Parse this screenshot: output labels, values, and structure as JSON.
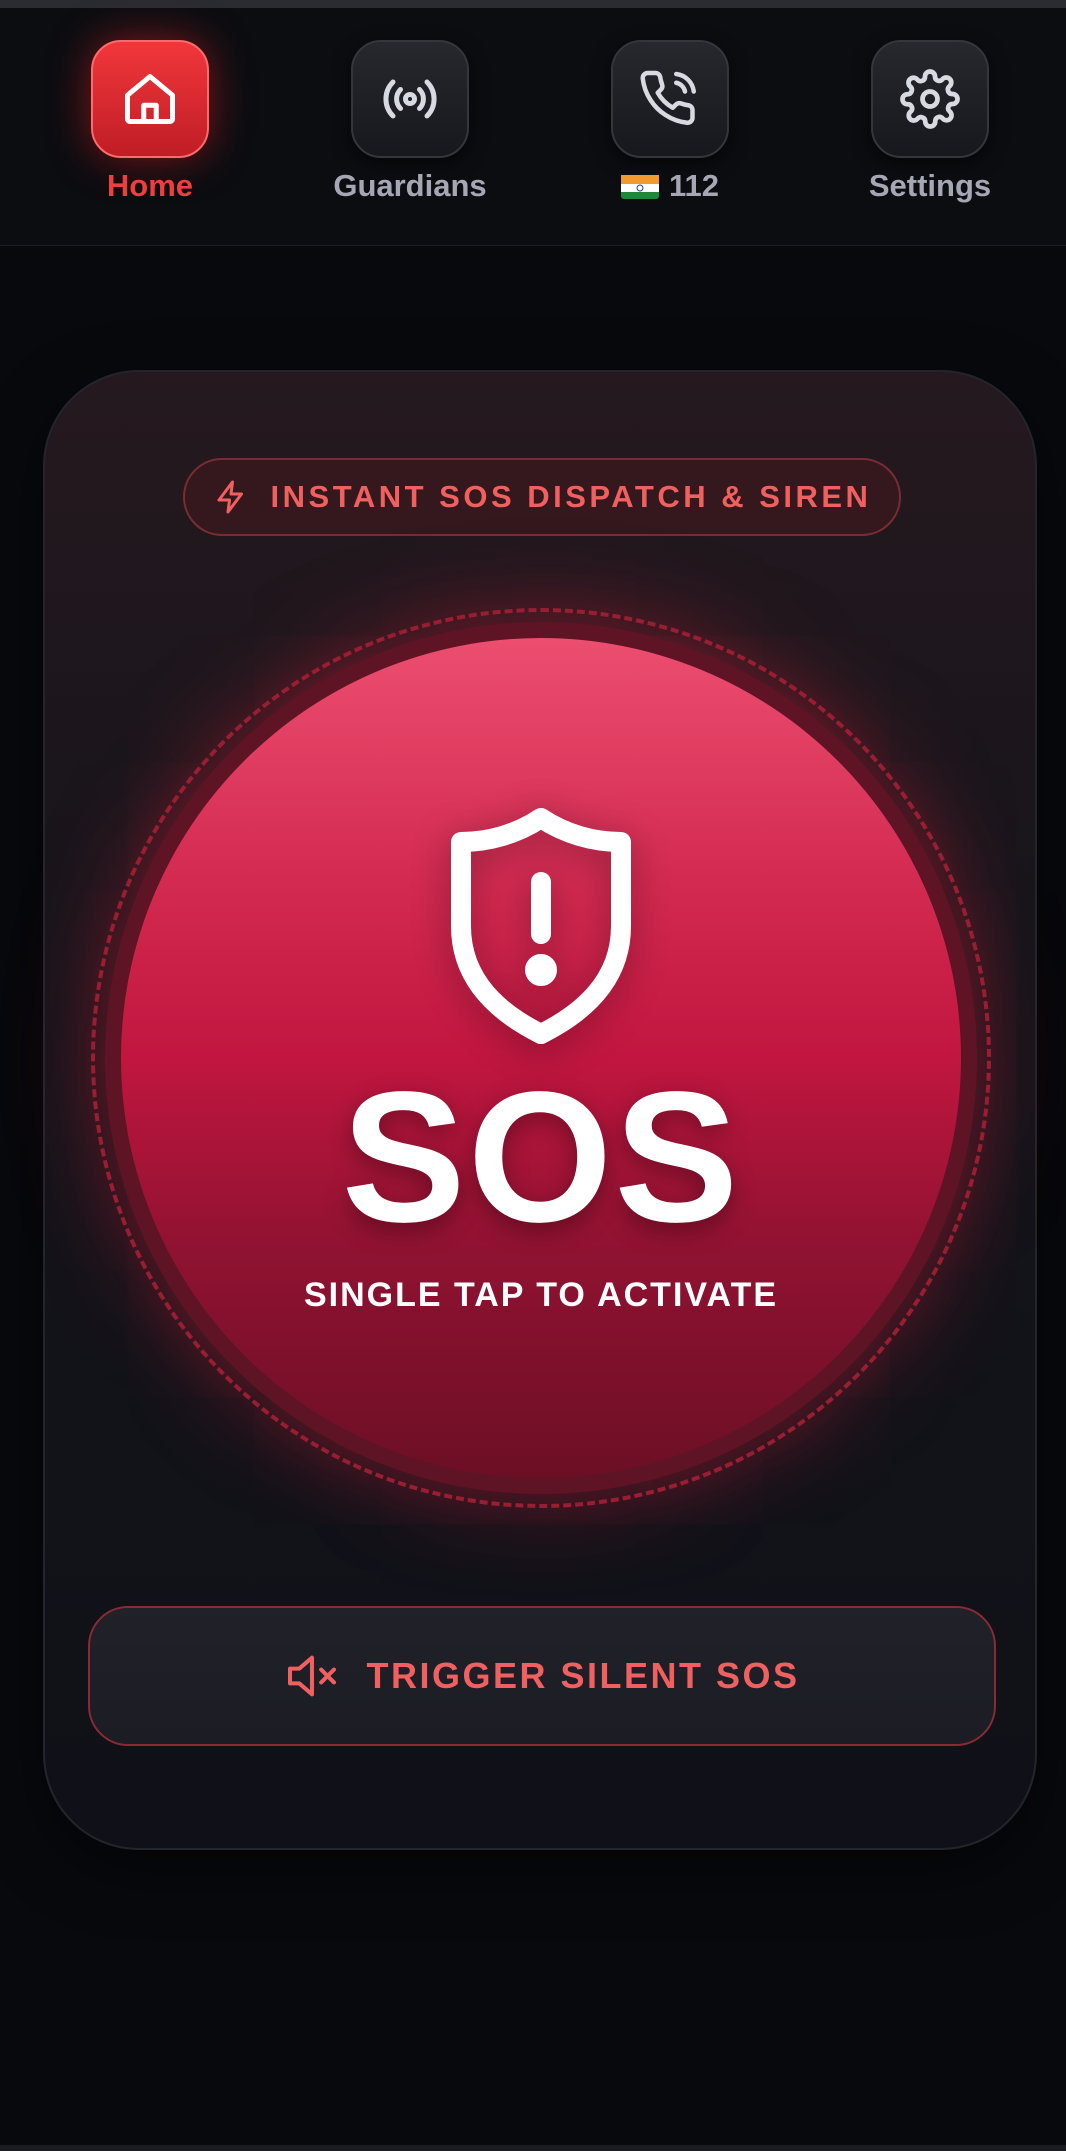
{
  "nav": {
    "items": [
      {
        "label": "Home",
        "icon": "home-icon",
        "active": true
      },
      {
        "label": "Guardians",
        "icon": "broadcast-icon",
        "active": false
      },
      {
        "label": "112",
        "icon": "phone-call-icon",
        "flag": "india-flag",
        "active": false
      },
      {
        "label": "Settings",
        "icon": "gear-icon",
        "active": false
      }
    ]
  },
  "card": {
    "badge": {
      "icon": "lightning-icon",
      "text": "INSTANT SOS DISPATCH & SIREN"
    },
    "sos": {
      "icon": "shield-alert-icon",
      "title": "SOS",
      "subtitle": "SINGLE TAP TO ACTIVATE"
    },
    "silent": {
      "icon": "mute-speaker-icon",
      "text": "TRIGGER SILENT SOS"
    }
  },
  "colors": {
    "accent": "#ef3e3e",
    "sos_top": "#ec4e70",
    "sos_bottom": "#6c0f25",
    "background": "#08090d"
  }
}
